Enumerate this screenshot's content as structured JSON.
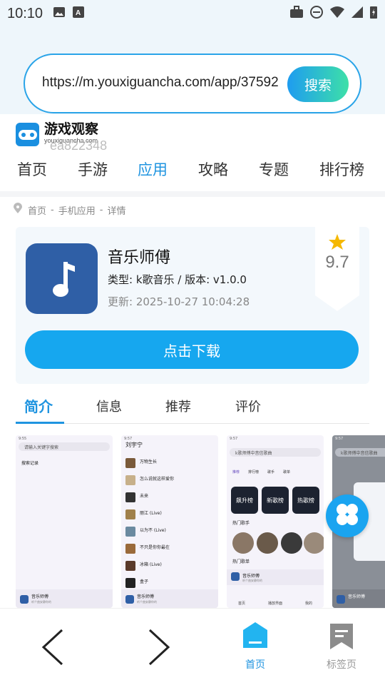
{
  "status_bar": {
    "time": "10:10"
  },
  "browser": {
    "url": "https://m.youxiguancha.com/app/37592",
    "search_label": "搜索"
  },
  "site": {
    "name": "游戏观察",
    "domain": "youxiguancha.com",
    "watermark": "ea822348"
  },
  "nav": {
    "items": [
      "首页",
      "手游",
      "应用",
      "攻略",
      "专题",
      "排行榜"
    ],
    "active": 2
  },
  "breadcrumb": [
    "首页",
    "手机应用",
    "详情"
  ],
  "app": {
    "name": "音乐师傅",
    "meta": "类型: k歌音乐 / 版本: v1.0.0",
    "update": "更新:  2025-10-27 10:04:28",
    "rating": "9.7",
    "download_label": "点击下载"
  },
  "tabs": [
    "简介",
    "信息",
    "推荐",
    "评价"
  ],
  "screenshots": [
    {
      "bar": "请输入关键字搜索",
      "section": "搜索记录",
      "mini_title": "音乐师傅",
      "mini_sub": "听个曲安静你的"
    },
    {
      "title": "刘宇宁",
      "rows": [
        "万物生长",
        "怎么说就这样爱你",
        "未来",
        "丽江 (Live)",
        "以为不 (Live)",
        "不只是你你最在",
        "冰箱 (Live)",
        "盒子"
      ],
      "mini_title": "音乐师傅",
      "mini_sub": "听个曲安静你的"
    },
    {
      "bar": "k歌师傅中音信歌曲",
      "tabs": [
        "推荐",
        "排行榜",
        "歌手",
        "歌单"
      ],
      "charts": [
        "飙升榜",
        "新歌榜",
        "热歌榜"
      ],
      "section": "热门歌手",
      "section2": "热门歌单",
      "mini_title": "音乐师傅",
      "mini_sub": "听个曲安静你的",
      "bottom": [
        "首页",
        "播放界面",
        "我的"
      ]
    },
    {
      "bar": "k歌师傅中音信歌曲",
      "mini_title": "音乐师傅"
    }
  ],
  "bottom_nav": {
    "back": "back",
    "forward": "forward",
    "home": "首页",
    "bookmarks": "标签页"
  },
  "colors": {
    "accent": "#1f94e0",
    "download": "#16a7ef",
    "app_icon": "#2f5fa6",
    "star": "#f5b800"
  }
}
